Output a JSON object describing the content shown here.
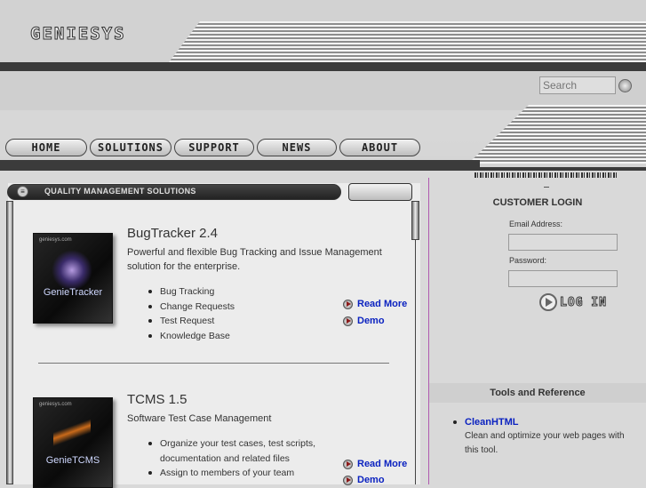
{
  "brand": {
    "logo_text": "GENIESYS"
  },
  "search": {
    "placeholder": "Search"
  },
  "nav": {
    "items": [
      {
        "label": "HOME"
      },
      {
        "label": "SOLUTIONS"
      },
      {
        "label": "SUPPORT"
      },
      {
        "label": "NEWS"
      },
      {
        "label": "ABOUT"
      }
    ]
  },
  "main": {
    "section_title": "QUALITY MANAGEMENT SOLUTIONS",
    "products": [
      {
        "title": "BugTracker 2.4",
        "box_label": "GenieTracker",
        "description": "Powerful and flexible Bug Tracking and Issue Management solution for the enterprise.",
        "features": [
          "Bug Tracking",
          "Change Requests",
          "Test Request",
          "Knowledge Base"
        ],
        "links": [
          "Read More",
          "Demo"
        ]
      },
      {
        "title": "TCMS 1.5",
        "box_label": "GenieTCMS",
        "description": "Software Test Case Management",
        "features": [
          "Organize your test cases, test scripts, documentation and related files",
          "Assign to members of your team"
        ],
        "links": [
          "Read More",
          "Demo"
        ]
      }
    ]
  },
  "login": {
    "title": "CUSTOMER LOGIN",
    "email_label": "Email Address:",
    "password_label": "Password:",
    "button_label": "LOG IN"
  },
  "tools": {
    "title": "Tools and Reference",
    "items": [
      {
        "name": "CleanHTML",
        "description": "Clean and optimize your web pages with this tool."
      }
    ]
  },
  "colors": {
    "link": "#0b22c0",
    "accent_line": "#b05ab0"
  },
  "icons": [
    "search-go-icon",
    "menu-icon",
    "arrow-icon",
    "target-icon",
    "login-arrow-icon"
  ]
}
